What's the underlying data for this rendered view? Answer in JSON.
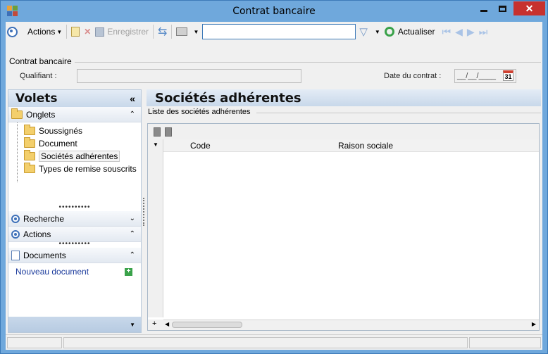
{
  "window": {
    "title": "Contrat bancaire",
    "minimize": "—",
    "maximize": "☐",
    "close": "✕"
  },
  "toolbar": {
    "actions_label": "Actions",
    "save_label": "Enregistrer",
    "search_value": "",
    "refresh_label": "Actualiser"
  },
  "header": {
    "group_title": "Contrat bancaire",
    "qualifiant_label": "Qualifiant :",
    "qualifiant_value": "",
    "date_label": "Date du contrat :",
    "date_value": "__/__/____",
    "calendar_day": "31"
  },
  "left_panel": {
    "title": "Volets",
    "onglets": {
      "label": "Onglets",
      "items": [
        "Soussignés",
        "Document",
        "Sociétés adhérentes",
        "Types de remise souscrits"
      ],
      "selected_index": 2
    },
    "recherche_label": "Recherche",
    "actions_label": "Actions",
    "documents": {
      "label": "Documents",
      "new_link": "Nouveau document"
    }
  },
  "main": {
    "title": "Sociétés adhérentes",
    "list_label": "Liste des sociétés adhérentes",
    "columns": [
      "Code",
      "Raison sociale"
    ]
  },
  "colors": {
    "accent": "#6fa8dc",
    "close": "#c7312e",
    "link": "#1a3a9c"
  }
}
